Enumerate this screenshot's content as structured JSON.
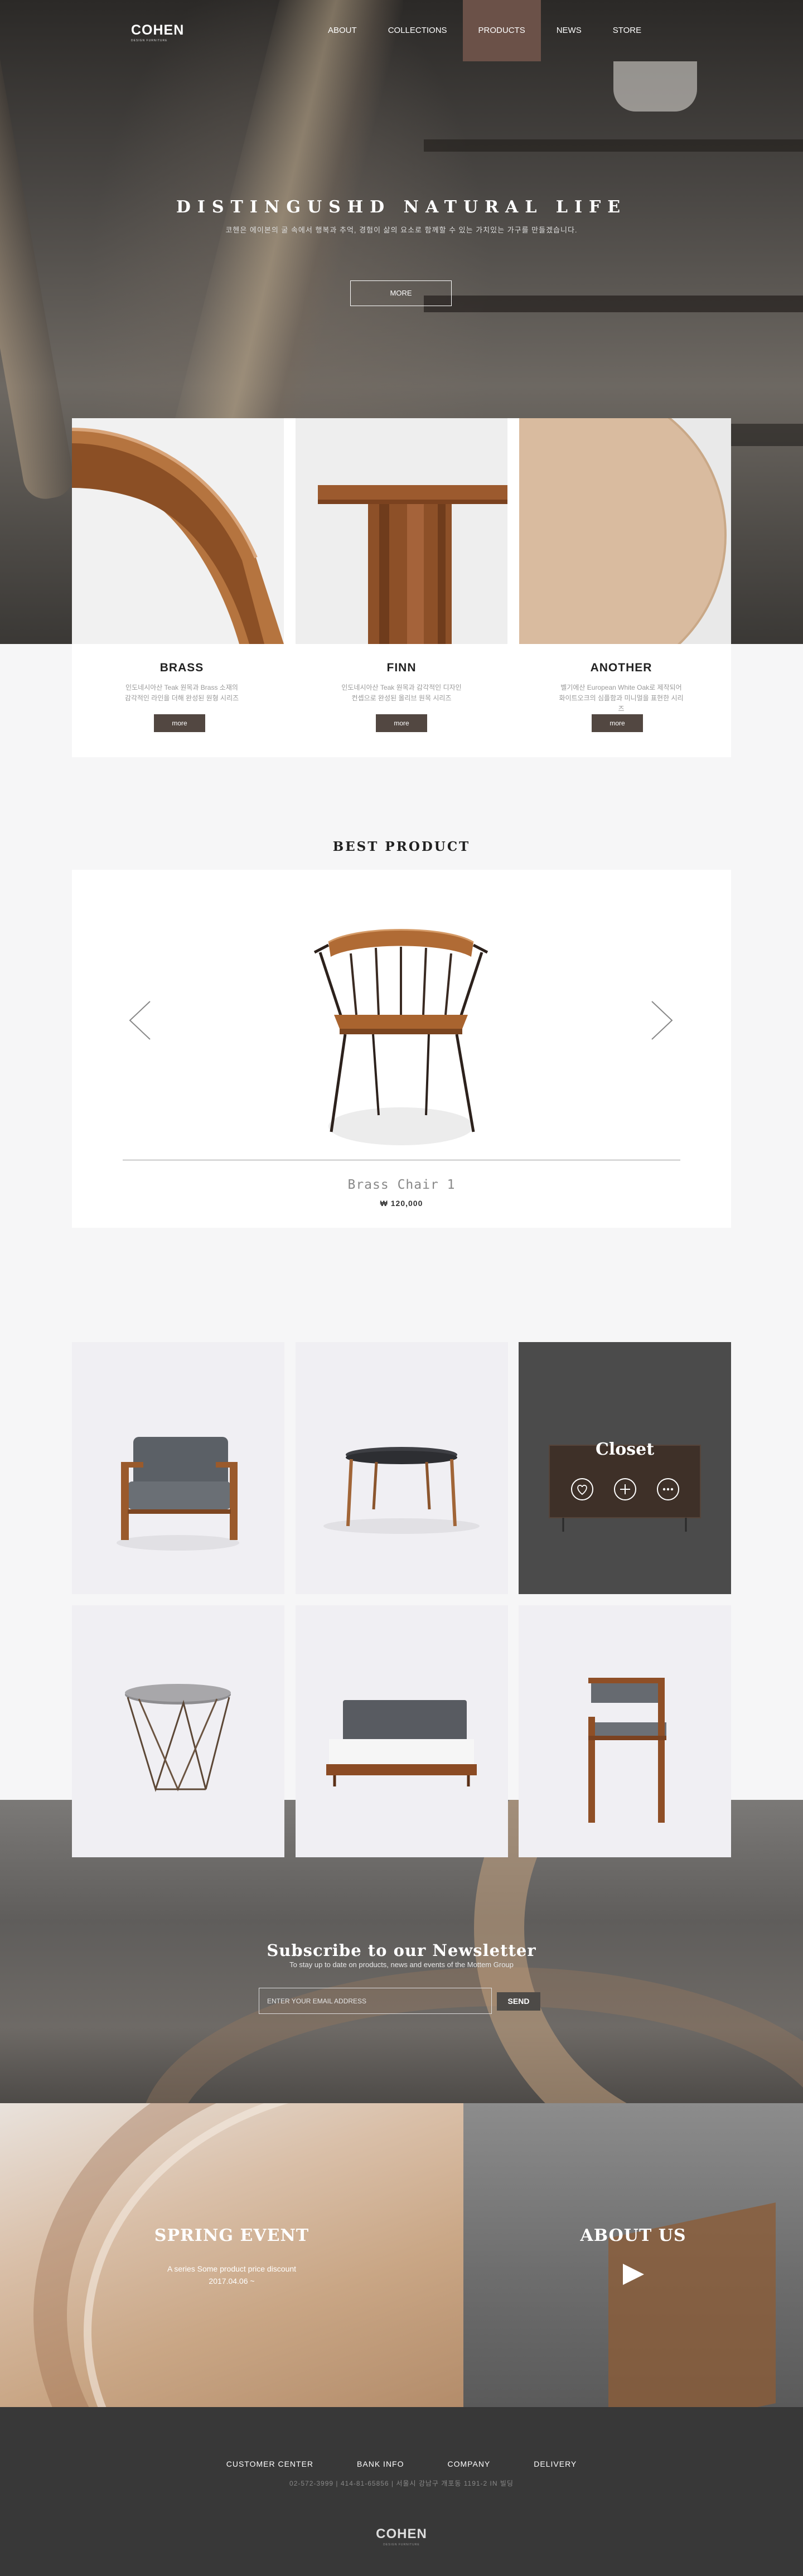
{
  "header": {
    "logo": "COHEN",
    "logo_tagline": "DESIGN FURNITURE",
    "nav": [
      {
        "label": "ABOUT"
      },
      {
        "label": "COLLECTIONS"
      },
      {
        "label": "PRODUCTS",
        "active": true
      },
      {
        "label": "NEWS"
      },
      {
        "label": "STORE"
      }
    ]
  },
  "hero": {
    "title": "DISTINGUSHD NATURAL LIFE",
    "subtitle": "코헨은 에이본의 굴 속에서 행복과 추억, 경험이 삶의 요소로 함께할 수 있는 가치있는 가구를 만들겠습니다.",
    "button": "MORE"
  },
  "features": [
    {
      "title": "BRASS",
      "desc_1": "인도네시아산 Teak 원목과 Brass 소재의",
      "desc_2": "감각적인 라인을 더해 완성된 원형 시리즈",
      "button": "more"
    },
    {
      "title": "FINN",
      "desc_1": "인도네시아산 Teak 원목과 감각적인 디자인",
      "desc_2": "컨셉으로 완성된 올리브 원목 시리즈",
      "button": "more"
    },
    {
      "title": "ANOTHER",
      "desc_1": "벨기에산 European White Oak로 제작되어",
      "desc_2": "화이트오크의 심플함과 미니멀을 표현한 시리즈",
      "button": "more"
    }
  ],
  "best_product": {
    "section_title": "BEST PRODUCT",
    "name": "Brass Chair 1",
    "price": "₩ 120,000"
  },
  "gallery": {
    "closet_title": "Closet",
    "closet_actions": [
      "heart-icon",
      "plus-icon",
      "more-icon"
    ]
  },
  "newsletter": {
    "title": "Subscribe to our Newsletter",
    "subtitle": "To stay up to date on products, news and events of the Mottem Group",
    "placeholder": "ENTER YOUR EMAIL ADDRESS",
    "button": "SEND"
  },
  "spring_event": {
    "title": "SPRING EVENT",
    "line1": "A series Some product price discount",
    "line2": "2017.04.06 ~"
  },
  "about": {
    "title": "ABOUT US"
  },
  "footer": {
    "menu": [
      "CUSTOMER CENTER",
      "BANK INFO",
      "COMPANY",
      "DELIVERY"
    ],
    "info": "02-572-3999   |   414-81-65856   |   서울시 강남구 개포동 1191-2 IN 빌딩",
    "logo": "COHEN",
    "logo_tagline": "DESIGN FURNITURE"
  },
  "colors": {
    "accent": "#6b5148",
    "button": "#524741",
    "footer_bg": "#383838"
  }
}
